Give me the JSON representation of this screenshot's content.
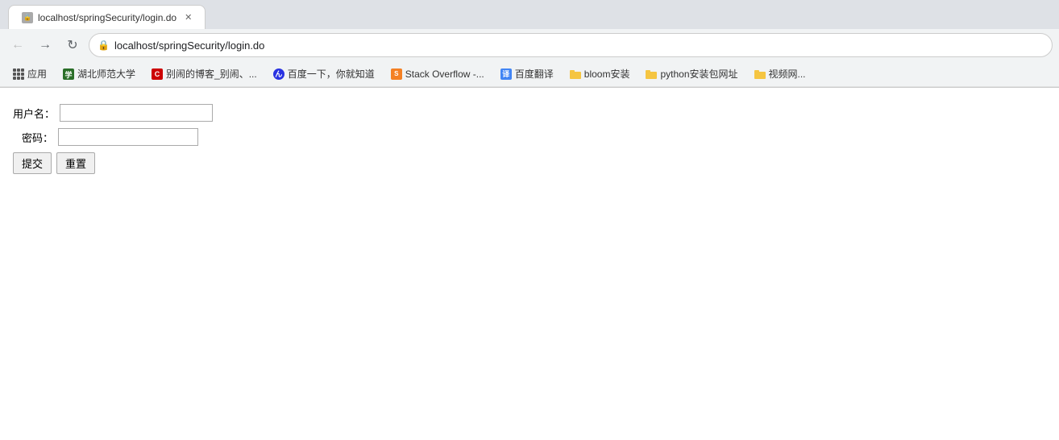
{
  "browser": {
    "tab_label": "localhost/springSecurity/login.do",
    "address": "localhost/springSecurity/login.do",
    "back_btn": "←",
    "forward_btn": "→",
    "reload_btn": "↻"
  },
  "bookmarks": {
    "apps_label": "应用",
    "items": [
      {
        "id": "hubei",
        "label": "湖北师范大学",
        "icon_type": "school"
      },
      {
        "id": "csdn",
        "label": "别闹的博客_别闹、...",
        "icon_type": "csdn"
      },
      {
        "id": "baidu",
        "label": "百度一下，你就知道",
        "icon_type": "baidu"
      },
      {
        "id": "stackoverflow",
        "label": "Stack Overflow -...",
        "icon_type": "so"
      },
      {
        "id": "baidufanyi",
        "label": "百度翻译",
        "icon_type": "translate"
      },
      {
        "id": "bloom",
        "label": "bloom安装",
        "icon_type": "folder"
      },
      {
        "id": "python",
        "label": "python安装包网址",
        "icon_type": "folder"
      },
      {
        "id": "video",
        "label": "视频网...",
        "icon_type": "folder"
      }
    ]
  },
  "form": {
    "username_label": "用户名：",
    "password_label": "密码：",
    "submit_label": "提交",
    "reset_label": "重置",
    "username_placeholder": "",
    "password_placeholder": ""
  }
}
